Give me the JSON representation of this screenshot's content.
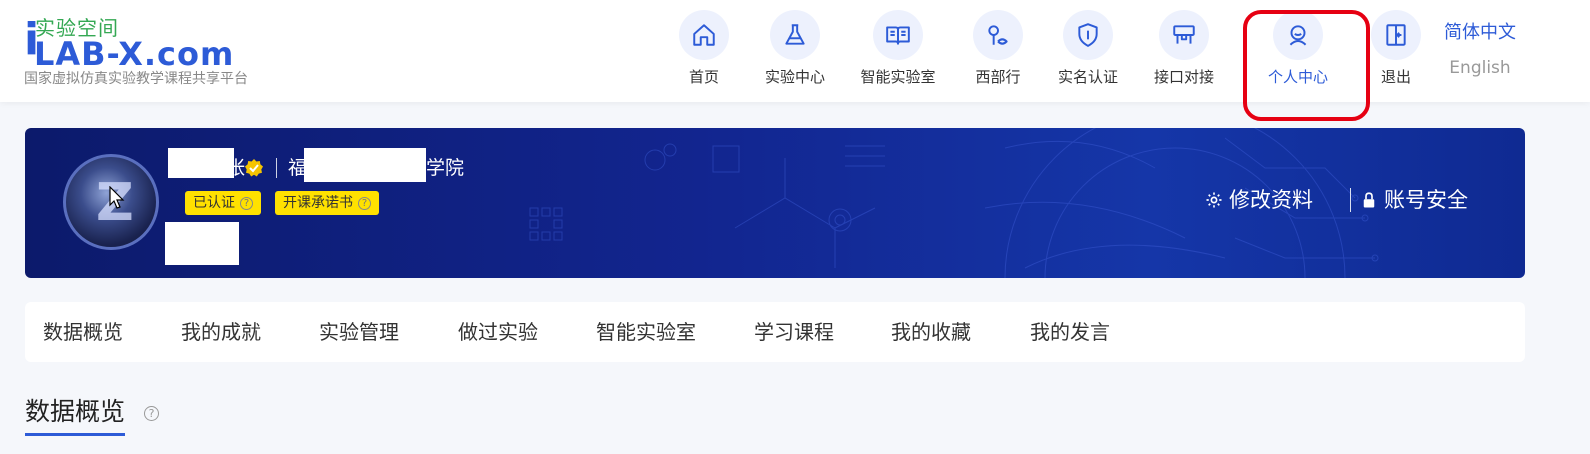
{
  "logo": {
    "cn_text": "实验空间",
    "main_text": "LAB-X.com",
    "subtitle": "国家虚拟仿真实验教学课程共享平台"
  },
  "nav": {
    "items": [
      {
        "label": "首页",
        "icon": "home-icon"
      },
      {
        "label": "实验中心",
        "icon": "flask-icon"
      },
      {
        "label": "智能实验室",
        "icon": "book-icon"
      },
      {
        "label": "西部行",
        "icon": "map-route-icon"
      },
      {
        "label": "实名认证",
        "icon": "shield-icon"
      },
      {
        "label": "接口对接",
        "icon": "interface-icon"
      },
      {
        "label": "个人中心",
        "icon": "user-icon"
      },
      {
        "label": "退出",
        "icon": "logout-icon"
      }
    ],
    "active": "个人中心"
  },
  "lang": {
    "cn": "简体中文",
    "en": "English"
  },
  "profile": {
    "name_suffix": "张",
    "school_prefix": "福",
    "school_suffix": "学院",
    "badges": [
      "已认证",
      "开课承诺书"
    ],
    "actions": {
      "edit": "修改资料",
      "security": "账号安全"
    }
  },
  "tabs": [
    "数据概览",
    "我的成就",
    "实验管理",
    "做过实验",
    "智能实验室",
    "学习课程",
    "我的收藏",
    "我的发言"
  ],
  "section": {
    "title": "数据概览"
  },
  "colors": {
    "accent": "#2d5bd7",
    "badge": "#ffe100",
    "highlight": "#e60012",
    "banner": "#12258f"
  }
}
